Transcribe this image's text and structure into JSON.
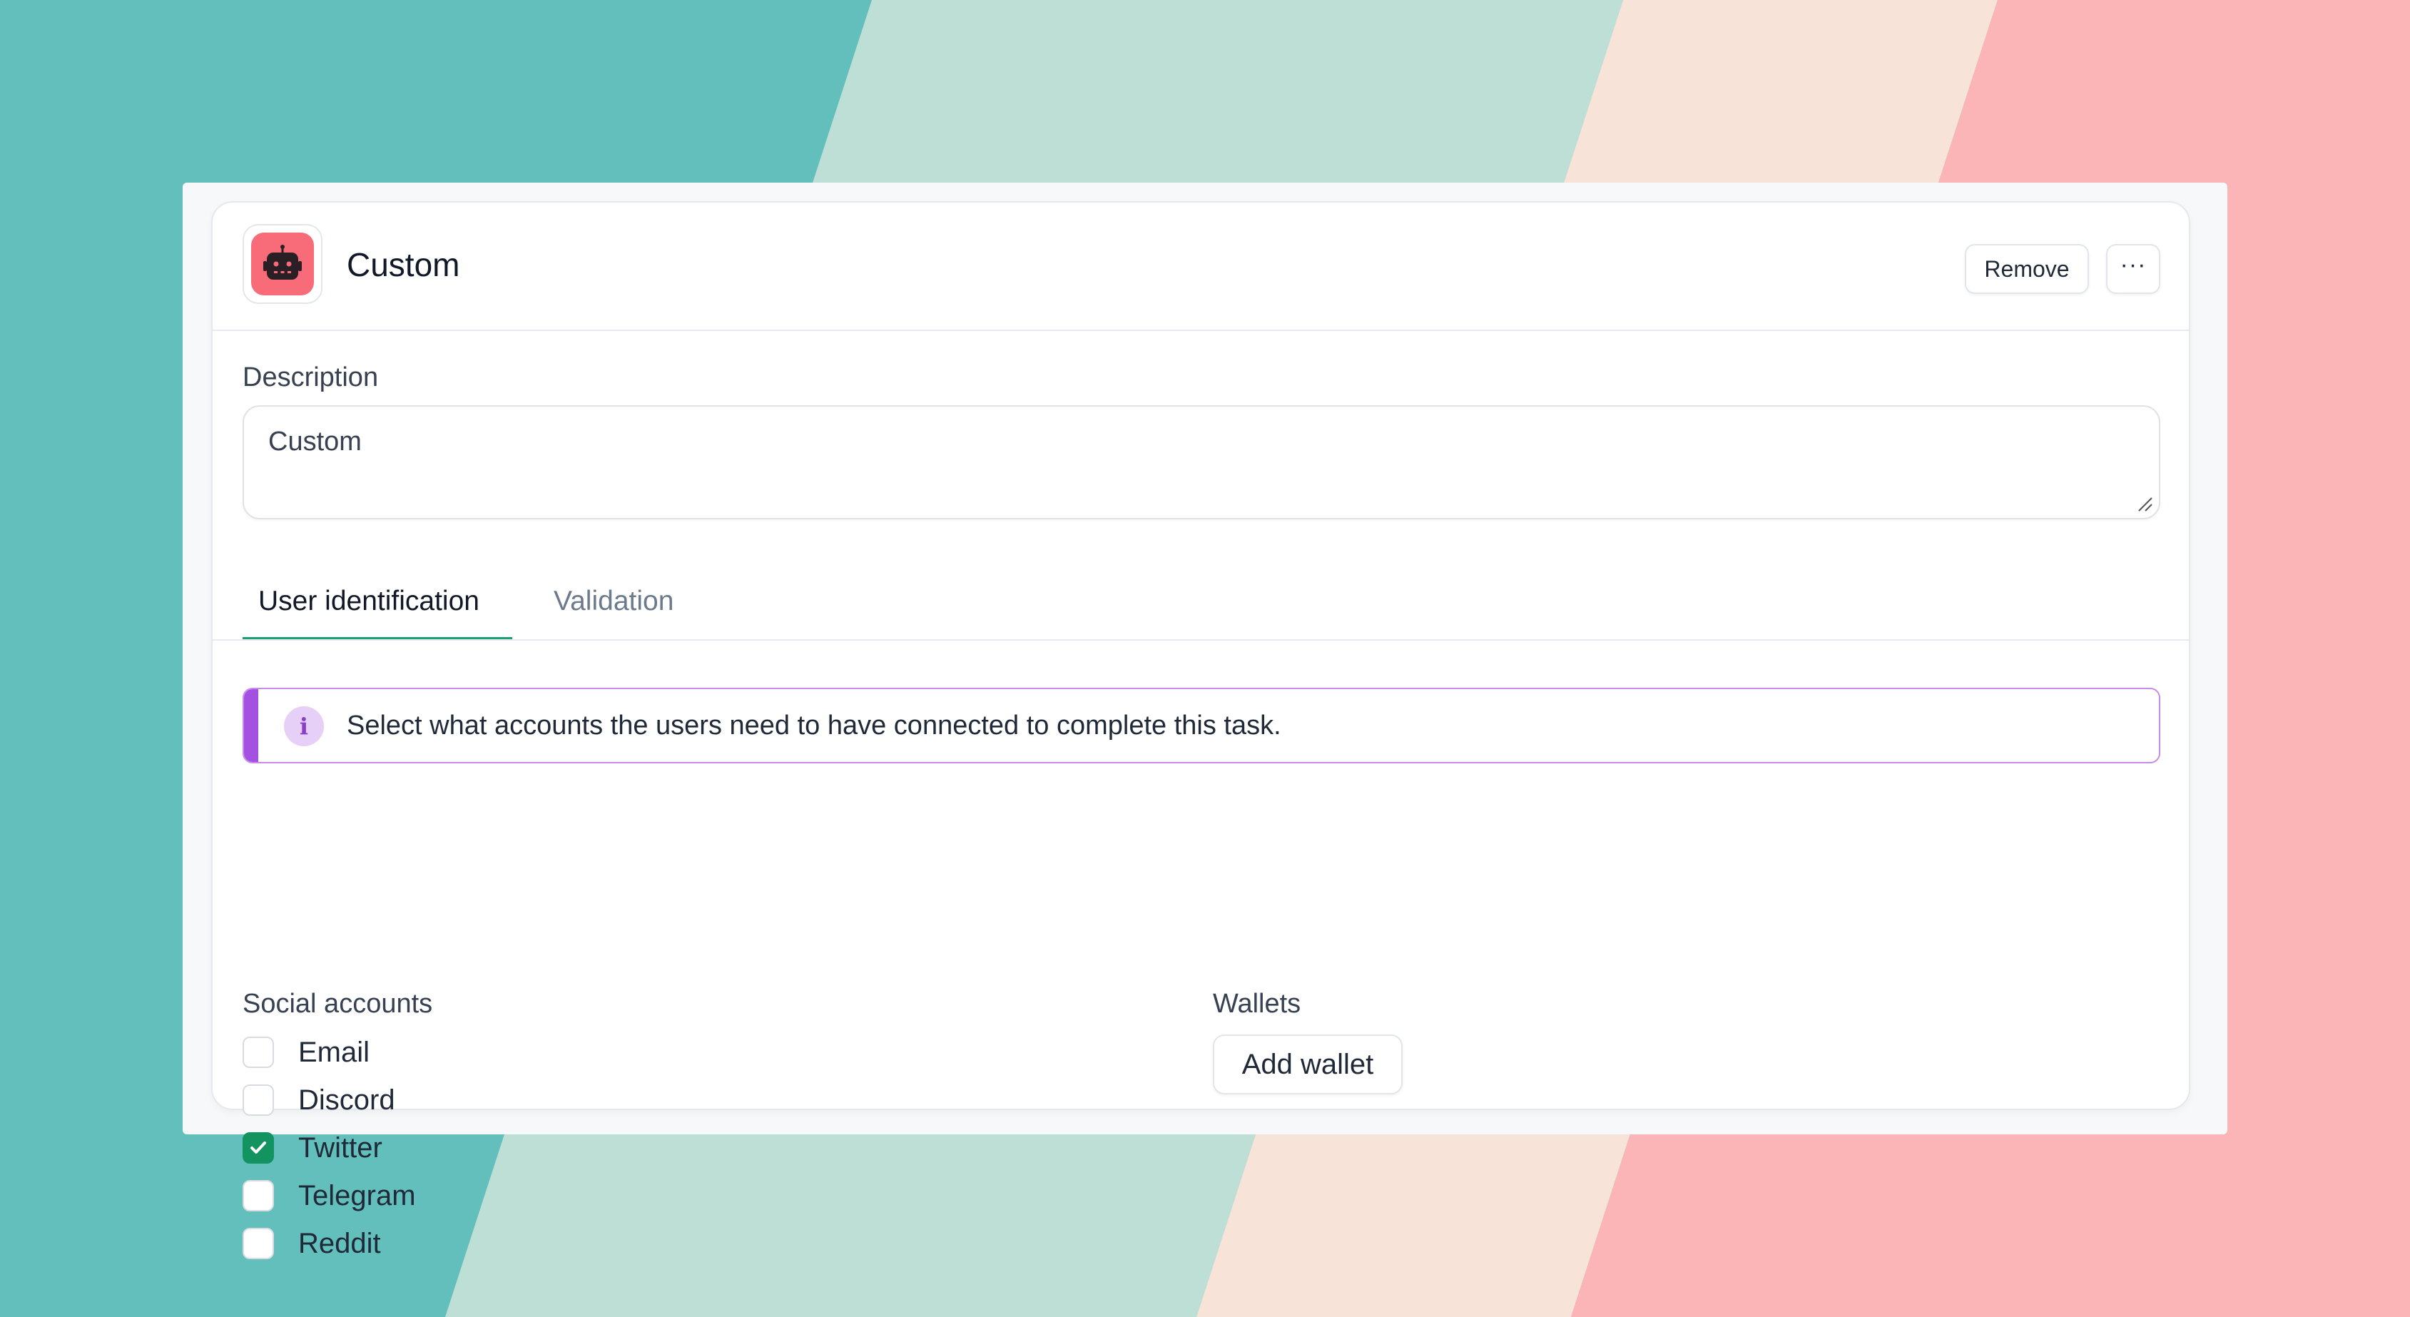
{
  "colors": {
    "bg_teal": "#63bfbc",
    "bg_mint": "#bddfd6",
    "bg_peach": "#f7e3d7",
    "bg_pink": "#fbb5b7",
    "accent_green": "#19a06e",
    "info_purple": "#a450e0",
    "icon_red": "#f86b78"
  },
  "header": {
    "app_icon": "robot-icon",
    "title": "Custom",
    "remove_label": "Remove",
    "more_label": "···"
  },
  "description": {
    "label": "Description",
    "value": "Custom"
  },
  "tabs": [
    {
      "label": "User identification",
      "active": true
    },
    {
      "label": "Validation",
      "active": false
    }
  ],
  "info": {
    "icon": "info-icon",
    "glyph": "i",
    "text": "Select what accounts the users need to have connected to complete this task."
  },
  "social": {
    "label": "Social accounts",
    "items": [
      {
        "label": "Email",
        "checked": false
      },
      {
        "label": "Discord",
        "checked": false
      },
      {
        "label": "Twitter",
        "checked": true
      },
      {
        "label": "Telegram",
        "checked": false
      },
      {
        "label": "Reddit",
        "checked": false
      }
    ]
  },
  "wallets": {
    "label": "Wallets",
    "add_label": "Add wallet"
  }
}
